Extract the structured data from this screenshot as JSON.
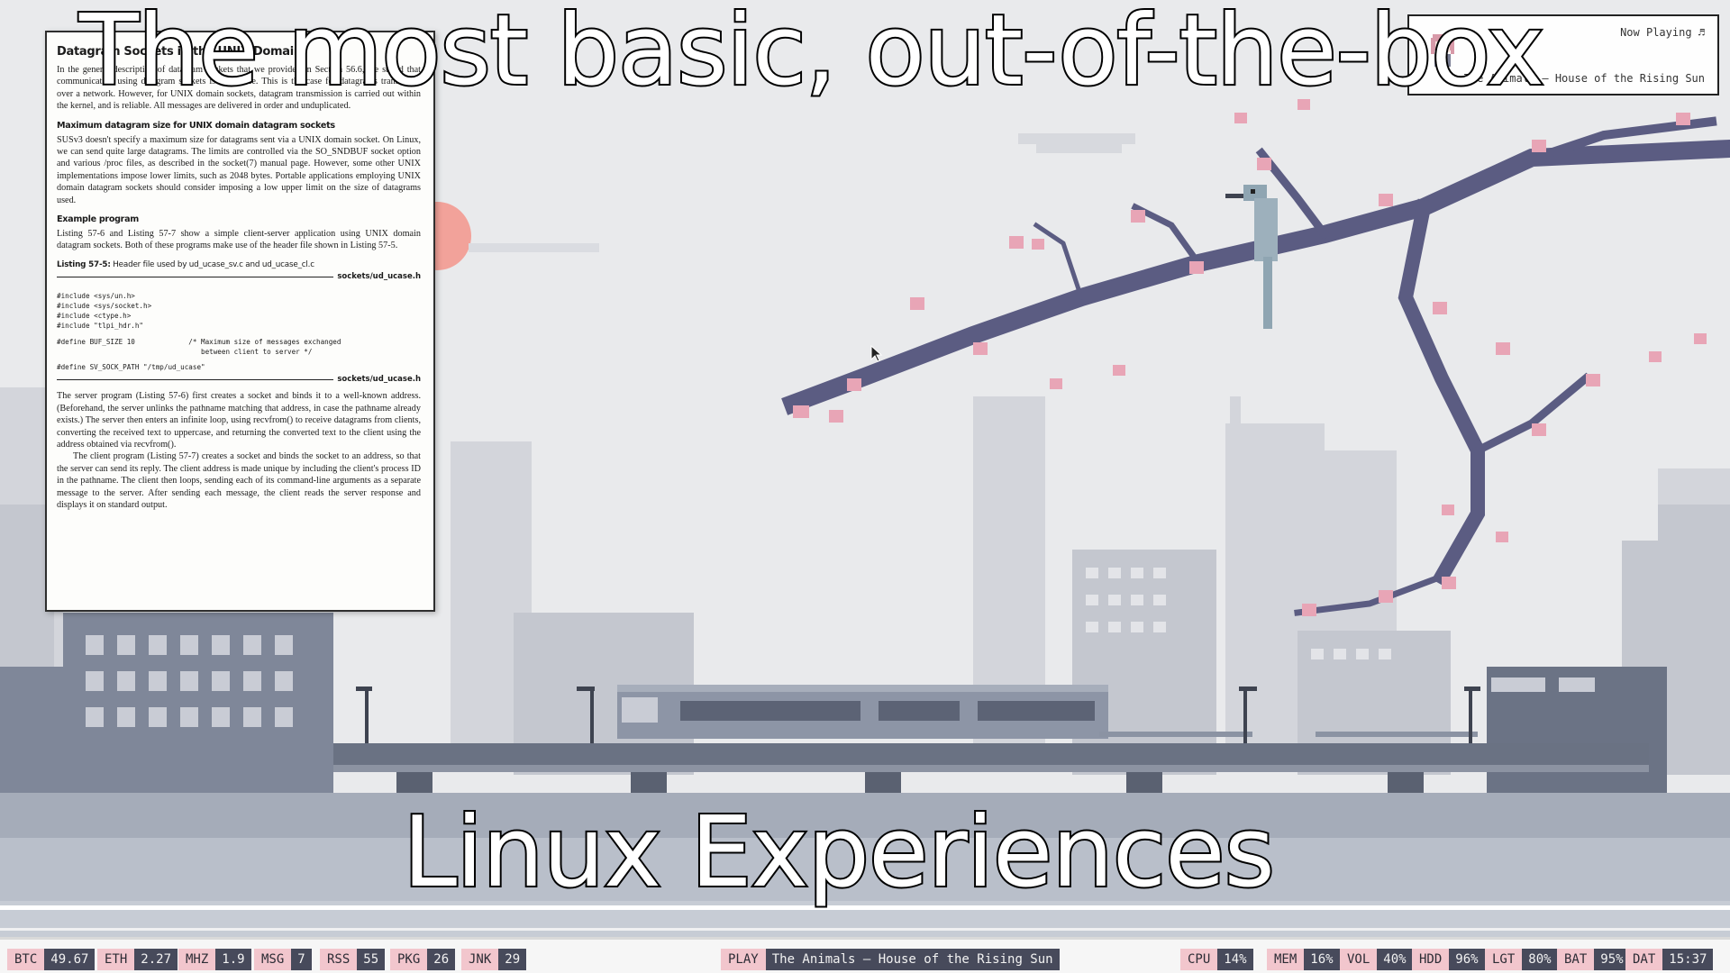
{
  "overlay": {
    "caption_top": "The most basic, out-of-the-box",
    "caption_bottom": "Linux Experiences"
  },
  "document": {
    "section_title": "Datagram Sockets in the UNIX Domain",
    "para1": "In the general description of datagram sockets that we provided in Section 56.6, we stated that communication using datagram sockets is unreliable. This is the case for datagrams transferred over a network. However, for UNIX domain sockets, datagram transmission is carried out within the kernel, and is reliable. All messages are delivered in order and unduplicated.",
    "sub1": "Maximum datagram size for UNIX domain datagram sockets",
    "para2": "SUSv3 doesn't specify a maximum size for datagrams sent via a UNIX domain socket. On Linux, we can send quite large datagrams. The limits are controlled via the SO_SNDBUF socket option and various /proc files, as described in the socket(7) manual page. However, some other UNIX implementations impose lower limits, such as 2048 bytes. Portable applications employing UNIX domain datagram sockets should consider imposing a low upper limit on the size of datagrams used.",
    "sub2": "Example program",
    "para3": "Listing 57-6 and Listing 57-7 show a simple client-server application using UNIX domain datagram sockets. Both of these programs make use of the header file shown in Listing 57-5.",
    "listing_label": "Listing 57-5:",
    "listing_caption": "Header file used by ud_ucase_sv.c and ud_ucase_cl.c",
    "listing_file": "sockets/ud_ucase.h",
    "code_includes": "#include <sys/un.h>\n#include <sys/socket.h>\n#include <ctype.h>\n#include \"tlpi_hdr.h\"",
    "code_define1": "#define BUF_SIZE 10             /* Maximum size of messages exchanged\n                                   between client to server */",
    "code_define2": "#define SV_SOCK_PATH \"/tmp/ud_ucase\"",
    "listing_file_end": "sockets/ud_ucase.h",
    "para4": "The server program (Listing 57-6) first creates a socket and binds it to a well-known address. (Beforehand, the server unlinks the pathname matching that address, in case the pathname already exists.) The server then enters an infinite loop, using recvfrom() to receive datagrams from clients, converting the received text to uppercase, and returning the converted text to the client using the address obtained via recvfrom().",
    "para5": "The client program (Listing 57-7) creates a socket and binds the socket to an address, so that the server can send its reply. The client address is made unique by including the client's process ID in the pathname. The client then loops, sending each of its command-line arguments as a separate message to the server. After sending each message, the client reads the server response and displays it on standard output."
  },
  "now_playing": {
    "label": "Now Playing ♬",
    "track": "The Animals — House of the Rising Sun"
  },
  "statusbar": {
    "left": [
      {
        "key": "BTC",
        "value": "49.67"
      },
      {
        "key": "ETH",
        "value": "2.27"
      },
      {
        "key": "MHZ",
        "value": "1.9"
      },
      {
        "key": "MSG",
        "value": "7"
      },
      {
        "key": "RSS",
        "value": "55"
      },
      {
        "key": "PKG",
        "value": "26"
      },
      {
        "key": "JNK",
        "value": "29"
      }
    ],
    "center": {
      "key": "PLAY",
      "value": "The Animals — House of the Rising Sun"
    },
    "right": [
      {
        "key": "CPU",
        "value": "14%"
      },
      {
        "key": "MEM",
        "value": "16%"
      },
      {
        "key": "VOL",
        "value": "40%"
      },
      {
        "key": "HDD",
        "value": "96%"
      },
      {
        "key": "LGT",
        "value": "80%"
      },
      {
        "key": "BAT",
        "value": "95%"
      },
      {
        "key": "DAT",
        "value": "15:37"
      }
    ]
  },
  "colors": {
    "status_key_bg": "#f2c6cd",
    "status_value_bg": "#474a5b",
    "wallpaper_sky": "#e9eaec",
    "blossom_pink": "#e8a5b6",
    "branch_purple": "#5b5c82"
  },
  "icons": {
    "cursor": "mouse-pointer-icon",
    "music_note": "music-note-icon",
    "avatar": "pixel-avatar-icon"
  }
}
